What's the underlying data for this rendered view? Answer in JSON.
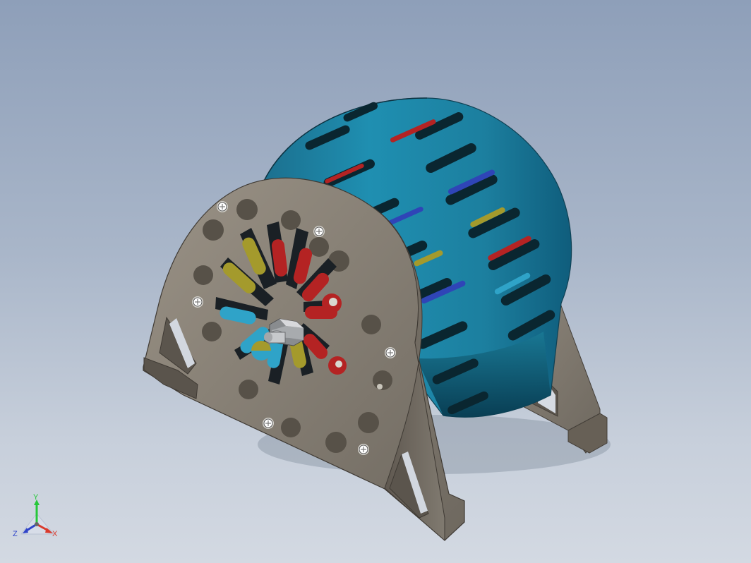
{
  "viewport": {
    "background_top": "#8e9fb9",
    "background_bottom": "#d3d9e2"
  },
  "model": {
    "drum_color": "#1f8fb1",
    "frame_color": "#8f877b",
    "magnet_colors": [
      "#b42323",
      "#2f45b7",
      "#a49a2c",
      "#2fa3c8"
    ]
  },
  "triad": {
    "y_label": "Y",
    "z_label": "Z",
    "x_label": "X",
    "y_color": "#27c73a",
    "z_color": "#2f44c8",
    "x_color": "#d93a2c"
  }
}
